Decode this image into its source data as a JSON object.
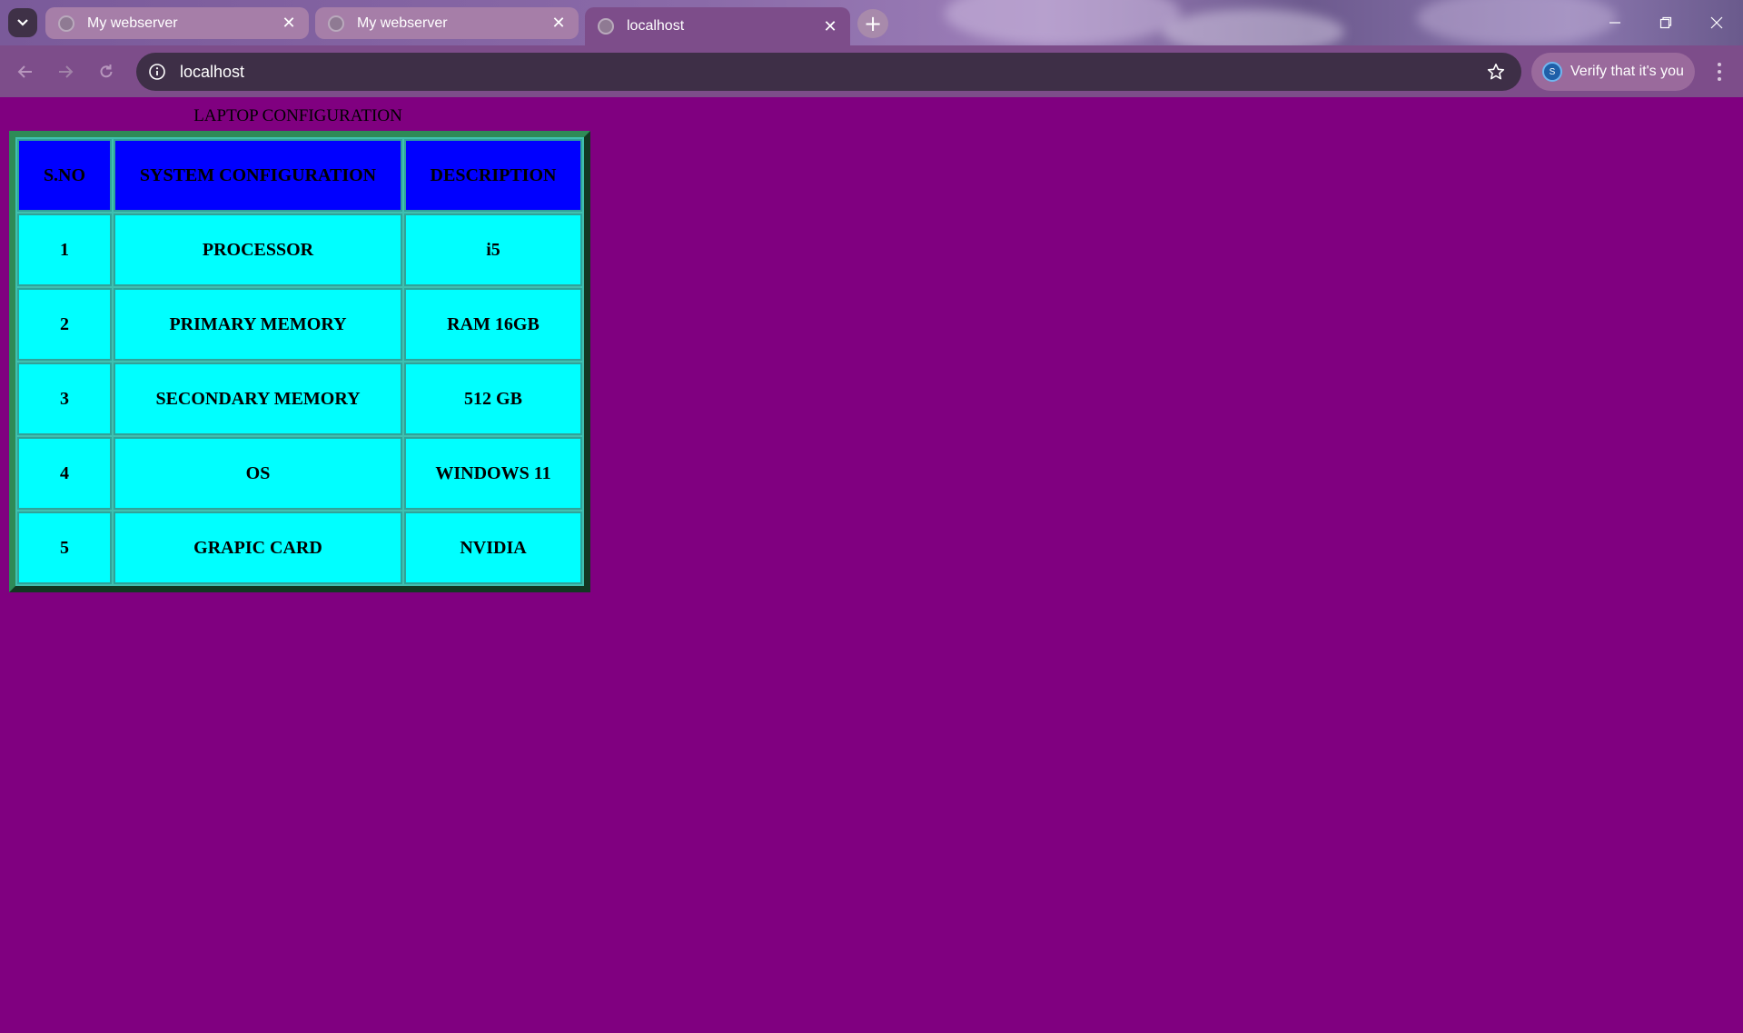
{
  "browser": {
    "tabs": [
      {
        "title": "My webserver",
        "active": false
      },
      {
        "title": "My webserver",
        "active": false
      },
      {
        "title": "localhost",
        "active": true
      }
    ],
    "url": "localhost",
    "verify_label": "Verify that it's you",
    "account_initial": "S"
  },
  "page": {
    "caption": "LAPTOP CONFIGURATION",
    "headers": [
      "S.NO",
      "SYSTEM CONFIGURATION",
      "DESCRIPTION"
    ],
    "rows": [
      [
        "1",
        "PROCESSOR",
        "i5"
      ],
      [
        "2",
        "PRIMARY MEMORY",
        "RAM 16GB"
      ],
      [
        "3",
        "SECONDARY MEMORY",
        "512 GB"
      ],
      [
        "4",
        "OS",
        "WINDOWS 11"
      ],
      [
        "5",
        "GRAPIC CARD",
        "NVIDIA"
      ]
    ]
  },
  "colors": {
    "page_background": "#800080",
    "header_cell": "#0000ff",
    "body_cell": "#00ffff",
    "table_border": "#2e8b57"
  }
}
